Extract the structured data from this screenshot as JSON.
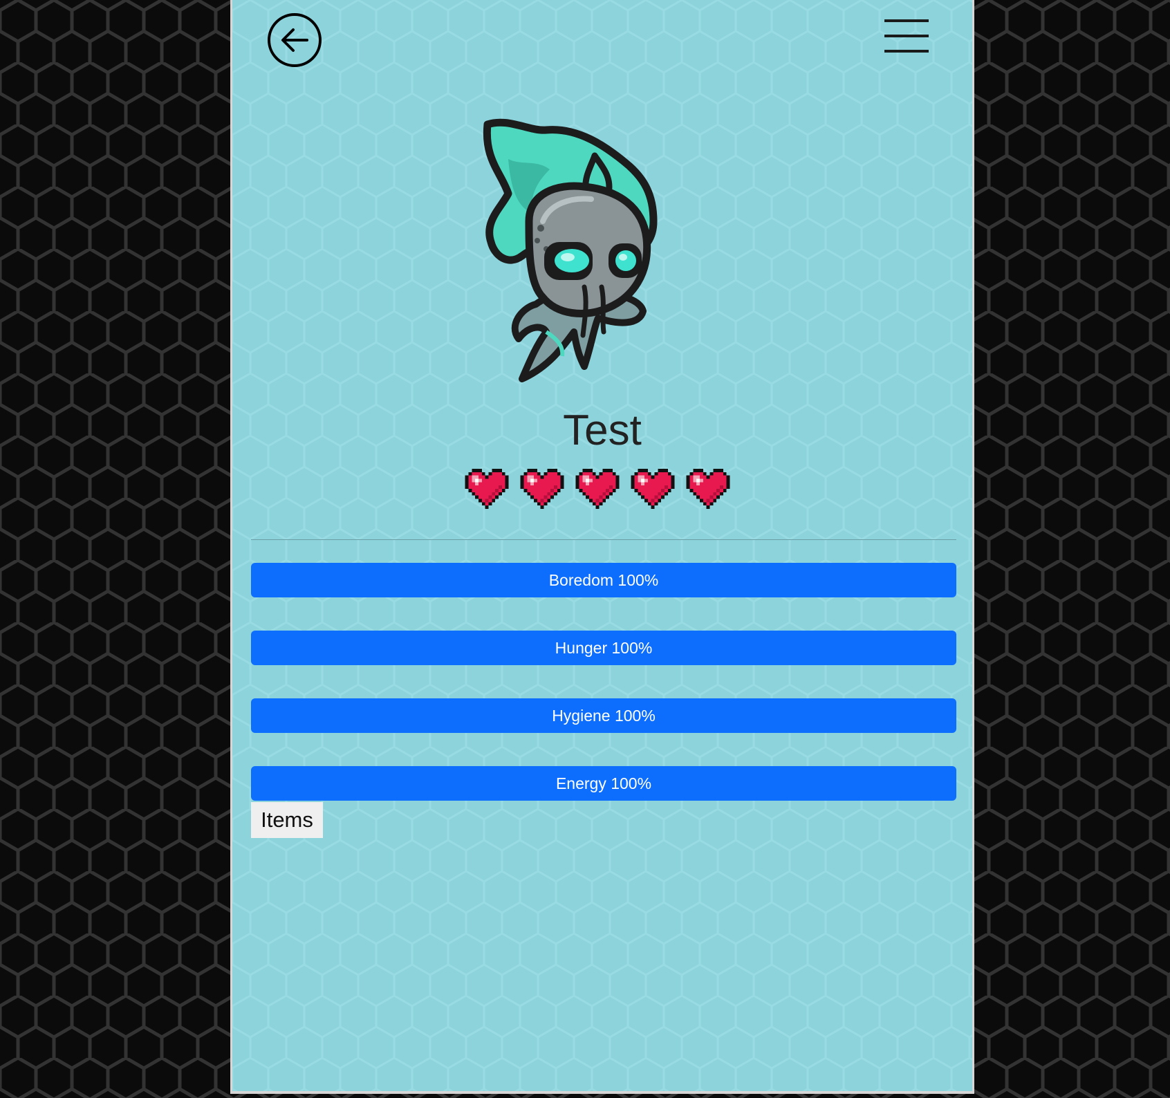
{
  "header": {
    "back_icon": "arrow-left-circle-icon",
    "menu_icon": "hamburger-menu-icon"
  },
  "pet": {
    "name": "Test",
    "image": "ghost-creature-sprite",
    "hearts": 5
  },
  "stats": [
    {
      "name": "Boredom",
      "label": "Boredom 100%",
      "value": 100
    },
    {
      "name": "Hunger",
      "label": "Hunger 100%",
      "value": 100
    },
    {
      "name": "Hygiene",
      "label": "Hygiene 100%",
      "value": 100
    },
    {
      "name": "Energy",
      "label": "Energy 100%",
      "value": 100
    }
  ],
  "items_button": {
    "label": "Items"
  },
  "colors": {
    "panel_background": "#8dd3dc",
    "page_background": "#0b0b0b",
    "progress_fill": "#0d6efd",
    "heart": "#e8194f"
  }
}
